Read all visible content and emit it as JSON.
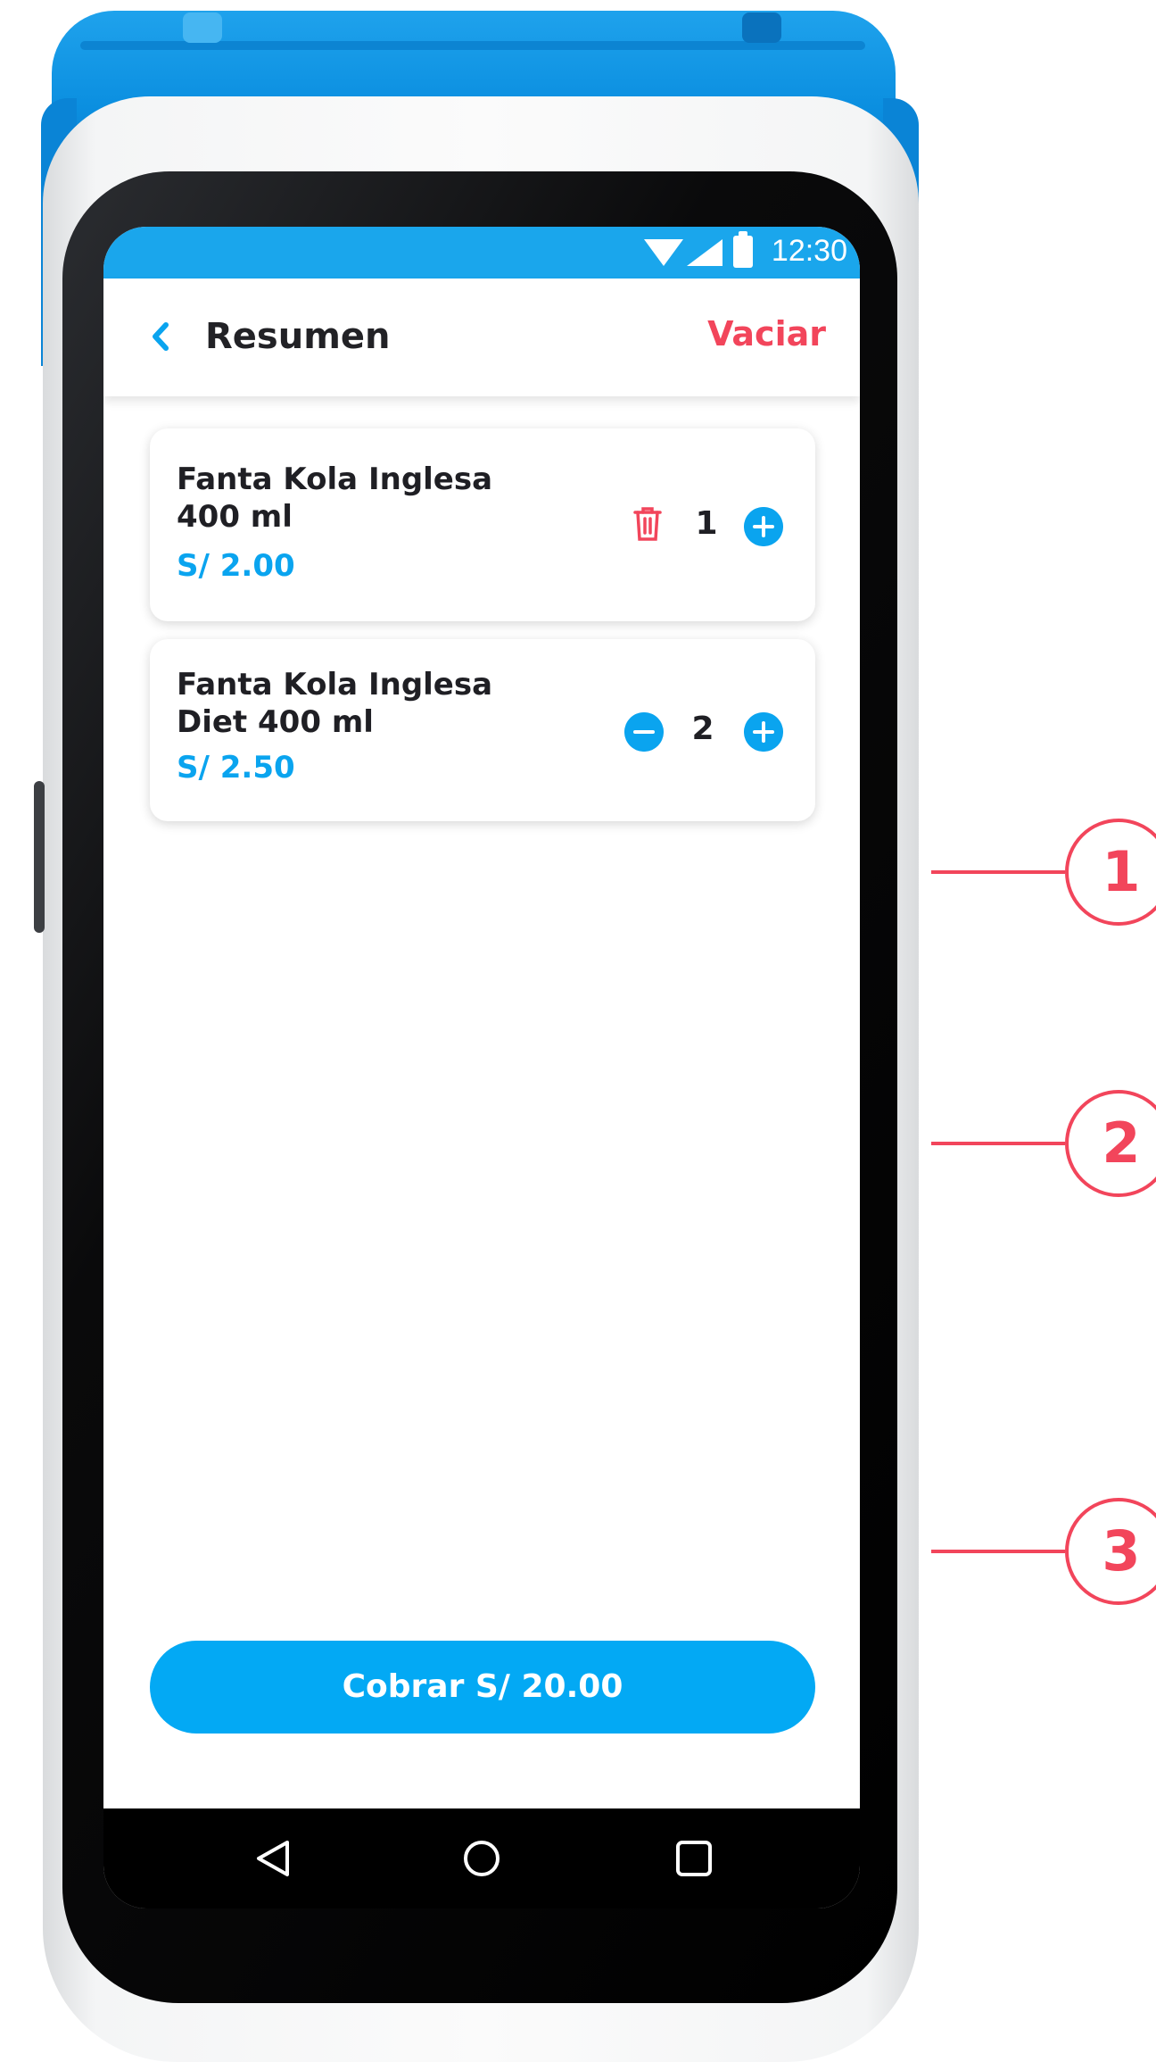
{
  "status_bar": {
    "time": "12:30"
  },
  "header": {
    "title": "Resumen",
    "clear_label": "Vaciar"
  },
  "cart": {
    "items": [
      {
        "name_line1": "Fanta Kola Inglesa",
        "name_line2": "400 ml",
        "price": "S/ 2.00",
        "quantity": "1"
      },
      {
        "name_line1": "Fanta Kola Inglesa",
        "name_line2": "Diet 400 ml",
        "price": "S/ 2.50",
        "quantity": "2"
      }
    ]
  },
  "checkout": {
    "label": "Cobrar S/ 20.00"
  },
  "callouts": [
    "1",
    "2",
    "3"
  ],
  "colors": {
    "accent": "#03a9f4",
    "danger": "#f2455b",
    "text": "#1f1f24"
  }
}
